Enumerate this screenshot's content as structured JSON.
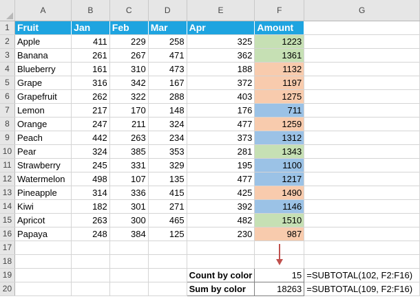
{
  "columns": [
    "A",
    "B",
    "C",
    "D",
    "E",
    "F",
    "G"
  ],
  "headers": [
    "Fruit",
    "Jan",
    "Feb",
    "Mar",
    "Apr",
    "Amount"
  ],
  "rows": [
    {
      "fruit": "Apple",
      "jan": "411",
      "feb": "229",
      "mar": "258",
      "apr": "325",
      "amount": "1223",
      "color": "green"
    },
    {
      "fruit": "Banana",
      "jan": "261",
      "feb": "267",
      "mar": "471",
      "apr": "362",
      "amount": "1361",
      "color": "green"
    },
    {
      "fruit": "Blueberry",
      "jan": "161",
      "feb": "310",
      "mar": "473",
      "apr": "188",
      "amount": "1132",
      "color": "orange"
    },
    {
      "fruit": "Grape",
      "jan": "316",
      "feb": "342",
      "mar": "167",
      "apr": "372",
      "amount": "1197",
      "color": "orange"
    },
    {
      "fruit": "Grapefruit",
      "jan": "262",
      "feb": "322",
      "mar": "288",
      "apr": "403",
      "amount": "1275",
      "color": "orange"
    },
    {
      "fruit": "Lemon",
      "jan": "217",
      "feb": "170",
      "mar": "148",
      "apr": "176",
      "amount": "711",
      "color": "blue"
    },
    {
      "fruit": "Orange",
      "jan": "247",
      "feb": "211",
      "mar": "324",
      "apr": "477",
      "amount": "1259",
      "color": "orange"
    },
    {
      "fruit": "Peach",
      "jan": "442",
      "feb": "263",
      "mar": "234",
      "apr": "373",
      "amount": "1312",
      "color": "blue"
    },
    {
      "fruit": "Pear",
      "jan": "324",
      "feb": "385",
      "mar": "353",
      "apr": "281",
      "amount": "1343",
      "color": "green"
    },
    {
      "fruit": "Strawberry",
      "jan": "245",
      "feb": "331",
      "mar": "329",
      "apr": "195",
      "amount": "1100",
      "color": "blue"
    },
    {
      "fruit": "Watermelon",
      "jan": "498",
      "feb": "107",
      "mar": "135",
      "apr": "477",
      "amount": "1217",
      "color": "blue"
    },
    {
      "fruit": "Pineapple",
      "jan": "314",
      "feb": "336",
      "mar": "415",
      "apr": "425",
      "amount": "1490",
      "color": "orange"
    },
    {
      "fruit": "Kiwi",
      "jan": "182",
      "feb": "301",
      "mar": "271",
      "apr": "392",
      "amount": "1146",
      "color": "blue"
    },
    {
      "fruit": "Apricot",
      "jan": "263",
      "feb": "300",
      "mar": "465",
      "apr": "482",
      "amount": "1510",
      "color": "green"
    },
    {
      "fruit": "Papaya",
      "jan": "248",
      "feb": "384",
      "mar": "125",
      "apr": "230",
      "amount": "987",
      "color": "orange"
    }
  ],
  "summary": {
    "count_label": "Count by color",
    "count_value": "15",
    "count_formula": "=SUBTOTAL(102, F2:F16)",
    "sum_label": "Sum by color",
    "sum_value": "18263",
    "sum_formula": "=SUBTOTAL(109, F2:F16)"
  },
  "colors": {
    "header_fill": "#1ea4e0",
    "green": "#c6e0b4",
    "orange": "#f8cbad",
    "blue": "#9bc2e6",
    "arrow": "#c0504d"
  },
  "icons": {
    "arrow": "down-arrow-icon"
  }
}
